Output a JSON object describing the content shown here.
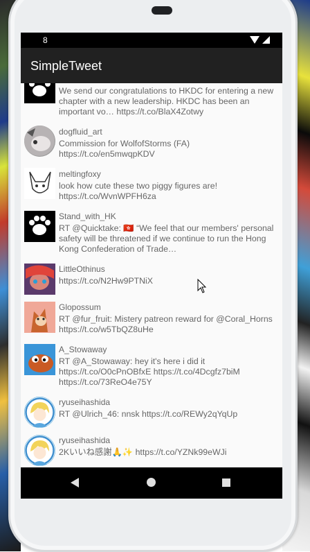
{
  "status_bar": {
    "time": "8"
  },
  "app_bar": {
    "title": "SimpleTweet"
  },
  "tweets": [
    {
      "name": "",
      "text": "We send our congratulations to HKDC for entering a new chapter with a new leadership. HKDC has been an important vo… https://t.co/BlaX4Zotwy",
      "avatar": "paw-logo-avatar"
    },
    {
      "name": "dogfluid_art",
      "text": "Commission for WolfofStorms (FA) https://t.co/en5mwqpKDV",
      "avatar": "grey-creature-avatar"
    },
    {
      "name": "meltingfoxy",
      "text": "look how cute these two piggy figures are! https://t.co/WvnWPFH6za",
      "avatar": "sketch-fox-avatar"
    },
    {
      "name": "Stand_with_HK",
      "text": "RT @Quicktake: 🇭🇰 “We feel that our members' personal safety will be threatened if we continue to run the Hong Kong Confederation of Trade…",
      "avatar": "paw-logo-avatar"
    },
    {
      "name": "LittleOthinus",
      "text": "https://t.co/N2Hw9PTNiX",
      "avatar": "colorful-character-avatar"
    },
    {
      "name": "Glopossum",
      "text": "RT @fur_fruit: Mistery patreon reward for @Coral_Horns https://t.co/w5TbQZ8uHe",
      "avatar": "fox-portrait-avatar"
    },
    {
      "name": "A_Stowaway",
      "text": "RT @A_Stowaway: hey it's here i did it https://t.co/O0cPnOBfxE https://t.co/4Dcgfz7biM https://t.co/73ReO4e75Y",
      "avatar": "orange-creature-avatar"
    },
    {
      "name": "ryuseihashida",
      "text": "RT @Ulrich_46: nnsk https://t.co/REWy2qYqUp",
      "avatar": "blonde-anime-avatar"
    },
    {
      "name": "ryuseihashida",
      "text": "2Kいいね感謝🙏✨ https://t.co/YZNk99eWJi",
      "avatar": "blonde-anime-avatar"
    }
  ]
}
